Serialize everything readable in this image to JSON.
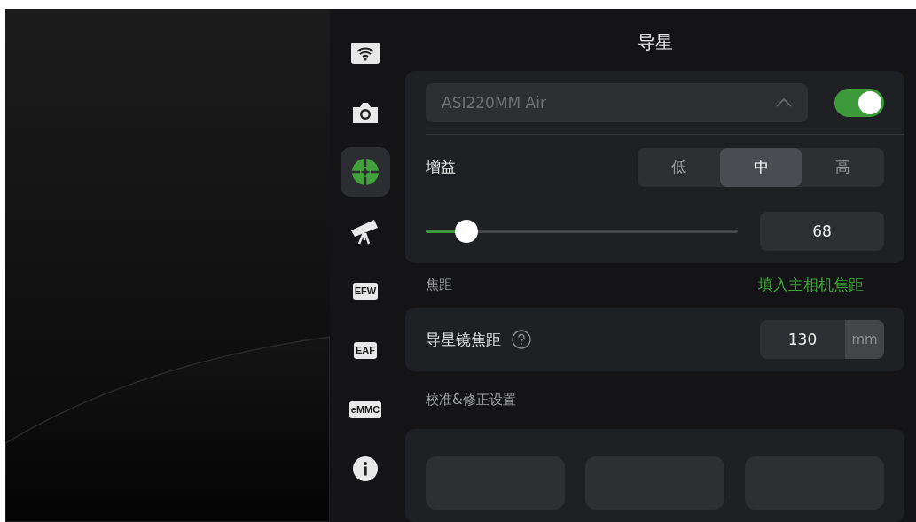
{
  "sidebar": {
    "items": [
      {
        "kind": "wifi",
        "selected": false
      },
      {
        "kind": "camera",
        "selected": false
      },
      {
        "kind": "guide",
        "selected": true
      },
      {
        "kind": "telescope",
        "selected": false
      },
      {
        "kind": "efw",
        "label": "EFW",
        "selected": false
      },
      {
        "kind": "eaf",
        "label": "EAF",
        "selected": false
      },
      {
        "kind": "emmc",
        "label": "eMMC",
        "selected": false
      },
      {
        "kind": "info",
        "selected": false
      }
    ]
  },
  "title": "导星",
  "camera_card": {
    "device": {
      "value": "ASI220MM Air"
    },
    "enabled": true,
    "gain": {
      "label": "增益",
      "options": [
        {
          "label": "低",
          "selected": false
        },
        {
          "label": "中",
          "selected": true
        },
        {
          "label": "高",
          "selected": false
        }
      ]
    },
    "slider": {
      "level": 0.13,
      "value": "68"
    }
  },
  "focal_section": {
    "label": "焦距",
    "link": "填入主相机焦距"
  },
  "focal_card": {
    "label": "导星镜焦距",
    "value": "130",
    "unit": "mm"
  },
  "calibration_section": {
    "label": "校准&修正设置",
    "buttons": [
      {
        "kind": "blank"
      },
      {
        "kind": "blank"
      },
      {
        "kind": "blank"
      }
    ]
  }
}
